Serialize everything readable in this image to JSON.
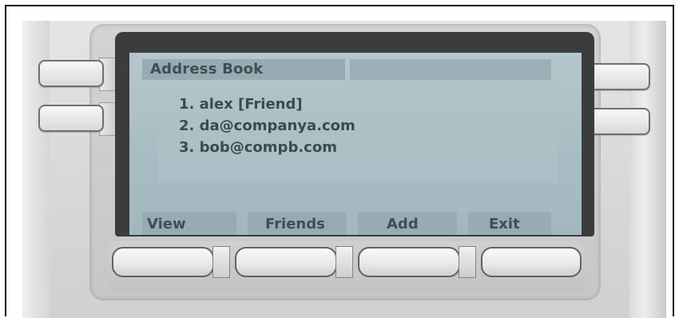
{
  "screen": {
    "title": "Address Book",
    "entries": [
      "1. alex [Friend]",
      "2. da@companya.com",
      "3. bob@compb.com"
    ]
  },
  "softkeys": [
    "View",
    "Friends",
    "Add",
    "Exit"
  ],
  "colors": {
    "lcd_background": "#a9bec4",
    "lcd_bar": "#97acb2",
    "lcd_text": "#3e4e55",
    "phone_body": "#d7d9d8"
  }
}
